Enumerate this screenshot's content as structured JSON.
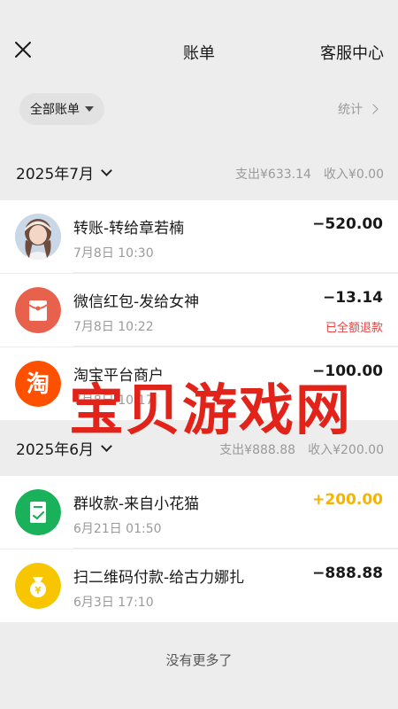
{
  "header": {
    "title": "账单",
    "service": "客服中心"
  },
  "filter": {
    "label": "全部账单",
    "stats": "统计"
  },
  "months": [
    {
      "label": "2025年7月",
      "expense": "支出¥633.14",
      "income": "收入¥0.00",
      "items": [
        {
          "name": "转账-转给章若楠",
          "time": "7月8日 10:30",
          "amount": "−520.00",
          "note": ""
        },
        {
          "name": "微信红包-发给女神",
          "time": "7月8日 10:22",
          "amount": "−13.14",
          "note": "已全额退款"
        },
        {
          "name": "淘宝平台商户",
          "time": "7月8日 10:17",
          "amount": "−100.00",
          "note": ""
        }
      ]
    },
    {
      "label": "2025年6月",
      "expense": "支出¥888.88",
      "income": "收入¥200.00",
      "items": [
        {
          "name": "群收款-来自小花猫",
          "time": "6月21日 01:50",
          "amount": "+200.00",
          "note": ""
        },
        {
          "name": "扫二维码付款-给古力娜扎",
          "time": "6月3日 17:10",
          "amount": "−888.88",
          "note": ""
        }
      ]
    }
  ],
  "footer": {
    "more": "没有更多了"
  },
  "watermark": "宝贝游戏网",
  "icons": {
    "taobao_glyph": "淘"
  },
  "colors": {
    "income": "#f6b400",
    "refund": "#e64340",
    "redpacket": "#e8614d",
    "taobao": "#ff5000",
    "group_collect": "#19b25a",
    "qrpay": "#f7c600"
  }
}
